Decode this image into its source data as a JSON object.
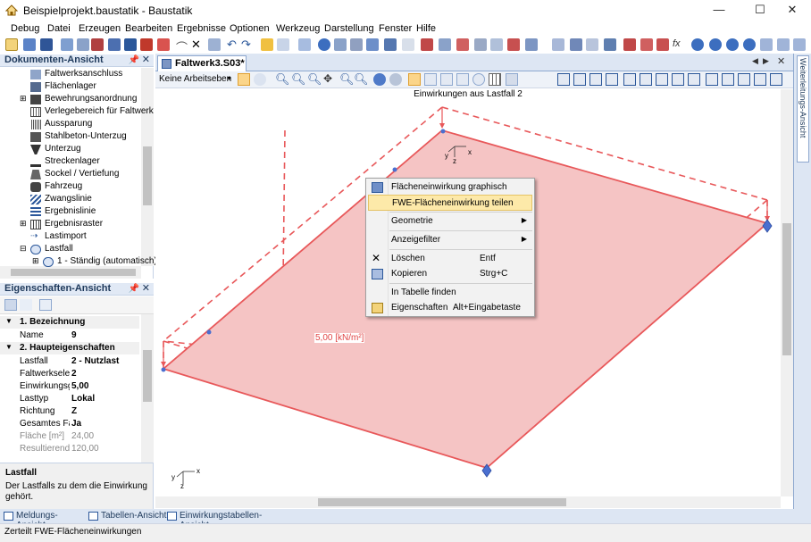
{
  "window": {
    "title": "Beispielprojekt.baustatik - Baustatik",
    "minimize": "—",
    "maximize": "☐",
    "close": "✕"
  },
  "menu": [
    "Debug",
    "Datei",
    "Erzeugen",
    "Bearbeiten",
    "Ergebnisse",
    "Optionen",
    "Werkzeug",
    "Darstellung",
    "Fenster",
    "Hilfe"
  ],
  "document_view": {
    "header": "Dokumenten-Ansicht",
    "pin": "📌",
    "close": "✕",
    "items": [
      {
        "label": "Faltwerksanschluss",
        "icon": "connection-icon"
      },
      {
        "label": "Flächenlager",
        "icon": "surface-support-icon"
      },
      {
        "label": "Bewehrungsanordnung",
        "icon": "reinforcement-icon"
      },
      {
        "label": "Verlegebereich für Faltwerk",
        "icon": "area-icon"
      },
      {
        "label": "Aussparung",
        "icon": "opening-icon"
      },
      {
        "label": "Stahlbeton-Unterzug",
        "icon": "beam-icon"
      },
      {
        "label": "Unterzug",
        "icon": "downstand-icon"
      },
      {
        "label": "Streckenlager",
        "icon": "line-support-icon"
      },
      {
        "label": "Sockel / Vertiefung",
        "icon": "pedestal-icon"
      },
      {
        "label": "Fahrzeug",
        "icon": "vehicle-icon"
      },
      {
        "label": "Zwangslinie",
        "icon": "constraint-line-icon"
      },
      {
        "label": "Ergebnislinie",
        "icon": "result-line-icon"
      },
      {
        "label": "Ergebnisraster",
        "icon": "result-grid-icon"
      },
      {
        "label": "Lastimport",
        "icon": "load-import-icon"
      },
      {
        "label": "Lastfall",
        "icon": "loadcase-icon"
      },
      {
        "label": "1 - Ständig (automatisch)",
        "icon": "loadcase-sub-icon"
      }
    ]
  },
  "properties_view": {
    "header": "Eigenschaften-Ansicht",
    "cat1": "1. Bezeichnung",
    "cat2": "2. Haupteigenschaften",
    "rows1": [
      {
        "k": "Name",
        "v": "9"
      }
    ],
    "rows2": [
      {
        "k": "Lastfall",
        "v": "2 - Nutzlast",
        "grey": false
      },
      {
        "k": "Faltwerkselement",
        "v": "2",
        "grey": false
      },
      {
        "k": "Einwirkungsgröße",
        "v": "5,00",
        "grey": false
      },
      {
        "k": "Lasttyp",
        "v": "Lokal",
        "grey": false
      },
      {
        "k": "Richtung",
        "v": "Z",
        "grey": false
      },
      {
        "k": "Gesamtes Faltwerk",
        "v": "Ja",
        "grey": false
      },
      {
        "k": "Fläche [m²]",
        "v": "24,00",
        "grey": true
      },
      {
        "k": "Resultierende",
        "v": "120,00",
        "grey": true
      }
    ],
    "desc_title": "Lastfall",
    "desc_text": "Der Lastfalls zu dem die Einwirkung gehört."
  },
  "document": {
    "tab": "Faltwerk3.S03*",
    "workplane": "Keine Arbeitseben",
    "caption": "Einwirkungen aus Lastfall 2",
    "load_label": "5,00 [kN/m²]",
    "axis_x": "x",
    "axis_y": "y",
    "axis_z": "z"
  },
  "right_panel": {
    "label": "Weiterleitungs-Ansicht"
  },
  "context_menu": {
    "items": [
      {
        "label": "Flächeneinwirkung graphisch",
        "shortcut": "",
        "arrow": "",
        "icon": "graphic-load-icon"
      },
      {
        "label": "FWE-Flächeneinwirkung teilen",
        "shortcut": "",
        "arrow": "",
        "icon": ""
      },
      {
        "label": "Geometrie",
        "shortcut": "",
        "arrow": "▶",
        "icon": ""
      },
      {
        "label": "Anzeigefilter",
        "shortcut": "",
        "arrow": "▶",
        "icon": ""
      },
      {
        "label": "Löschen",
        "shortcut": "Entf",
        "arrow": "",
        "icon": "delete-icon"
      },
      {
        "label": "Kopieren",
        "shortcut": "Strg+C",
        "arrow": "",
        "icon": "copy-icon"
      },
      {
        "label": "In Tabelle finden",
        "shortcut": "",
        "arrow": "",
        "icon": ""
      },
      {
        "label": "Eigenschaften",
        "shortcut": "Alt+Eingabetaste",
        "arrow": "",
        "icon": "properties-icon"
      }
    ]
  },
  "bottom_tabs": [
    "Meldungs-Ansicht",
    "Tabellen-Ansicht",
    "Einwirkungstabellen-Ansicht"
  ],
  "status": "Zerteilt FWE-Flächeneinwirkungen",
  "colors": {
    "load_fill": "#f5c4c4",
    "load_edge": "#e8585a",
    "accent": "#2b579a",
    "highlight": "#fde9a9"
  }
}
